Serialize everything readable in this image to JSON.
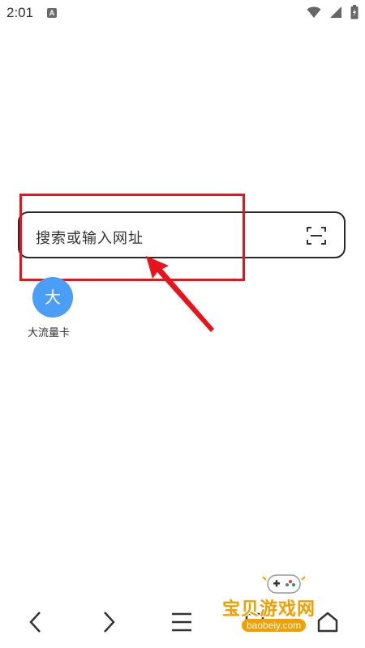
{
  "status_bar": {
    "time": "2:01",
    "notification_letter": "A",
    "icons": [
      "wifi-icon",
      "cell-signal-icon",
      "battery-icon"
    ]
  },
  "search": {
    "placeholder": "搜索或输入网址",
    "scan_icon": "scan-icon"
  },
  "quick_links": [
    {
      "icon_text": "大",
      "label": "大流量卡",
      "color": "#4a9ef5"
    }
  ],
  "bottom_nav": {
    "items": [
      "back-icon",
      "forward-icon",
      "menu-icon",
      "tabs-icon",
      "home-icon"
    ]
  },
  "annotation": {
    "color": "#e8141c"
  },
  "watermark": {
    "brand": "宝贝游戏网",
    "url": "baobeiy.com",
    "color": "#f0a000"
  }
}
